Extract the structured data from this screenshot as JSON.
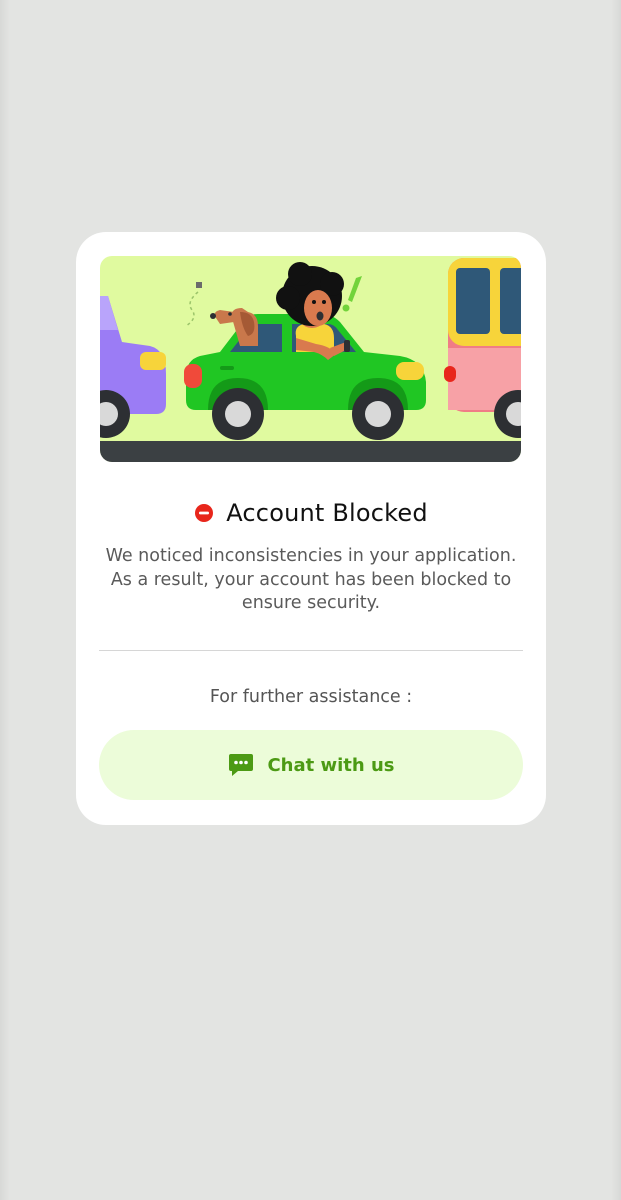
{
  "modal": {
    "title": "Account Blocked",
    "description": "We noticed inconsistencies in your application. As a result, your account has been blocked to ensure security.",
    "assist_text": "For further assistance :",
    "chat_button_label": "Chat with us"
  },
  "icons": {
    "status": "blocked-icon",
    "chat": "chat-bubble-icon"
  },
  "colors": {
    "background": "#e3e4e2",
    "card": "#ffffff",
    "title": "#111111",
    "body_text": "#5a5a5a",
    "blocked_red": "#e8261b",
    "chat_button_bg": "#ecfcd9",
    "chat_accent": "#4c9a14",
    "illustration_bg": "#e0fa9f"
  }
}
